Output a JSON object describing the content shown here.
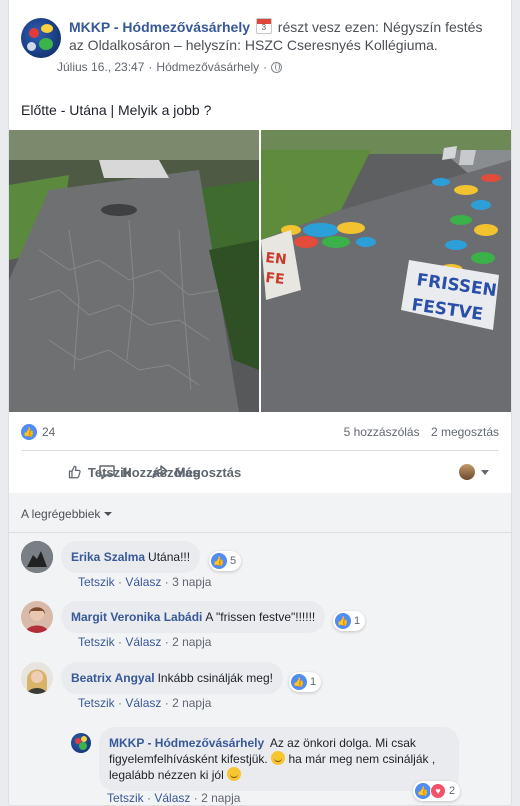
{
  "post": {
    "page_name": "MKKP - Hódmezővásárhely",
    "calendar_day": "3",
    "action_text": "részt vesz ezen: Négyszín festés az Oldalkosáron – helyszín: HSZC Cseresnyés Kollégiuma.",
    "timestamp": "Július 16., 23:47",
    "location": "Hódmezővásárhely",
    "text": "Előtte - Utána | Melyik a jobb ?"
  },
  "photo": {
    "left_icon": "before-photo",
    "right_icon": "after-photo",
    "sign_left_text": "EN\nFE",
    "sign_right_text": "FRISSEN\nFESTVE"
  },
  "stats": {
    "likes": "24",
    "comments": "5 hozzászólás",
    "shares": "2 megosztás"
  },
  "actions": {
    "like": "Tetszik",
    "comment": "Hozzászólás",
    "share": "Megosztás"
  },
  "sort_label": "A legrégebbiek",
  "comments": [
    {
      "author": "Erika Szalma",
      "text": "Utána!!!",
      "reactions": "5",
      "like": "Tetszik",
      "reply": "Válasz",
      "time": "3 napja"
    },
    {
      "author": "Margit Veronika Labádi",
      "text": "A \"frissen festve\"!!!!!!",
      "reactions": "1",
      "like": "Tetszik",
      "reply": "Válasz",
      "time": "2 napja"
    },
    {
      "author": "Beatrix Angyal",
      "text": "Inkább csinálják meg!",
      "reactions": "1",
      "like": "Tetszik",
      "reply": "Válasz",
      "time": "2 napja"
    }
  ],
  "reply": {
    "author": "MKKP - Hódmezővásárhely",
    "text1": "Az az önkori dolga. Mi csak figyelemfelhívásként kifestjük.",
    "text2": "ha már meg nem csinálják , legalább nézzen ki jól",
    "reactions": "2",
    "like": "Tetszik",
    "reply": "Válasz",
    "time": "2 napja"
  },
  "colors": {
    "link": "#385898",
    "like_blue": "#4f8cf3",
    "love_red": "#f25268"
  }
}
